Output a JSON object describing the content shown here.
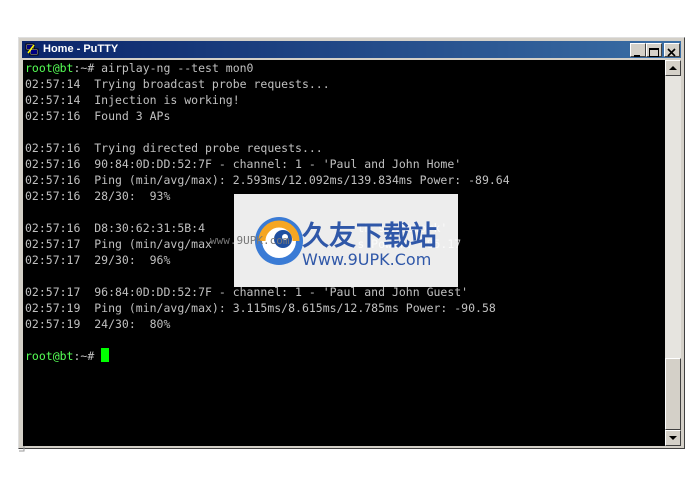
{
  "window": {
    "title": "Home - PuTTY",
    "icon": "putty-icon",
    "controls": [
      "minimize-icon",
      "maximize-icon",
      "close-icon"
    ]
  },
  "terminal": {
    "lines": [
      {
        "prompt": "root@bt",
        "rest": ":~# airplay-ng --test mon0"
      },
      {
        "text": "02:57:14  Trying broadcast probe requests..."
      },
      {
        "text": "02:57:14  Injection is working!"
      },
      {
        "text": "02:57:16  Found 3 APs"
      },
      {
        "text": ""
      },
      {
        "text": "02:57:16  Trying directed probe requests..."
      },
      {
        "text": "02:57:16  90:84:0D:DD:52:7F - channel: 1 - 'Paul and John Home'"
      },
      {
        "text": "02:57:16  Ping (min/avg/max): 2.593ms/12.092ms/139.834ms Power: -89.64"
      },
      {
        "text": "02:57:16  28/30:  93%"
      },
      {
        "text": ""
      },
      {
        "text": "02:57:16  D8:30:62:31:5B:4                      th's Network'"
      },
      {
        "text": "02:57:17  Ping (min/avg/max                     s Power: -85.17"
      },
      {
        "text": "02:57:17  29/30:  96%"
      },
      {
        "text": ""
      },
      {
        "text": "02:57:17  96:84:0D:DD:52:7F - channel: 1 - 'Paul and John Guest'"
      },
      {
        "text": "02:57:19  Ping (min/avg/max): 3.115ms/8.615ms/12.785ms Power: -90.58"
      },
      {
        "text": "02:57:19  24/30:  80%"
      },
      {
        "text": ""
      },
      {
        "prompt": "root@bt",
        "rest": ":~# ",
        "cursor": true
      }
    ]
  },
  "watermark": {
    "name": "久友下载站",
    "url": "Www.9UPK.Com",
    "overlay": "www.9UPK.com"
  },
  "colors": {
    "titlebar": "#0a246a",
    "terminal_bg": "#000000",
    "terminal_fg": "#c0c0c0",
    "prompt": "#55ff55",
    "cursor": "#00ff00",
    "watermark_text": "#2f57a8"
  }
}
